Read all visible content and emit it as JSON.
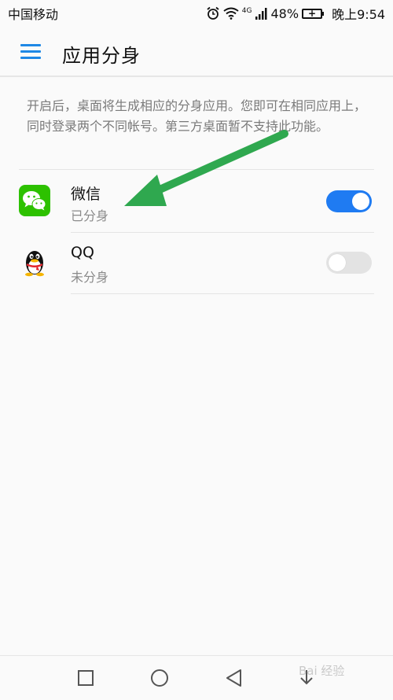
{
  "status_bar": {
    "carrier": "中国移动",
    "network": "4G",
    "battery": "48%",
    "time": "晚上9:54"
  },
  "header": {
    "title": "应用分身"
  },
  "description": "开启后，桌面将生成相应的分身应用。您即可在相同应用上，同时登录两个不同帐号。第三方桌面暂不支持此功能。",
  "apps": [
    {
      "name": "微信",
      "status": "已分身",
      "enabled": true,
      "icon": "wechat-icon"
    },
    {
      "name": "QQ",
      "status": "未分身",
      "enabled": false,
      "icon": "qq-icon"
    }
  ],
  "nav_bar": {
    "buttons": [
      "recent-apps-icon",
      "home-icon",
      "back-icon",
      "download-icon"
    ]
  },
  "watermark": "Bai 经验",
  "colors": {
    "accent": "#1f7bf2",
    "menu_icon": "#1e88e5",
    "wechat_green": "#2dc100",
    "annotation_arrow": "#2fa84f"
  }
}
